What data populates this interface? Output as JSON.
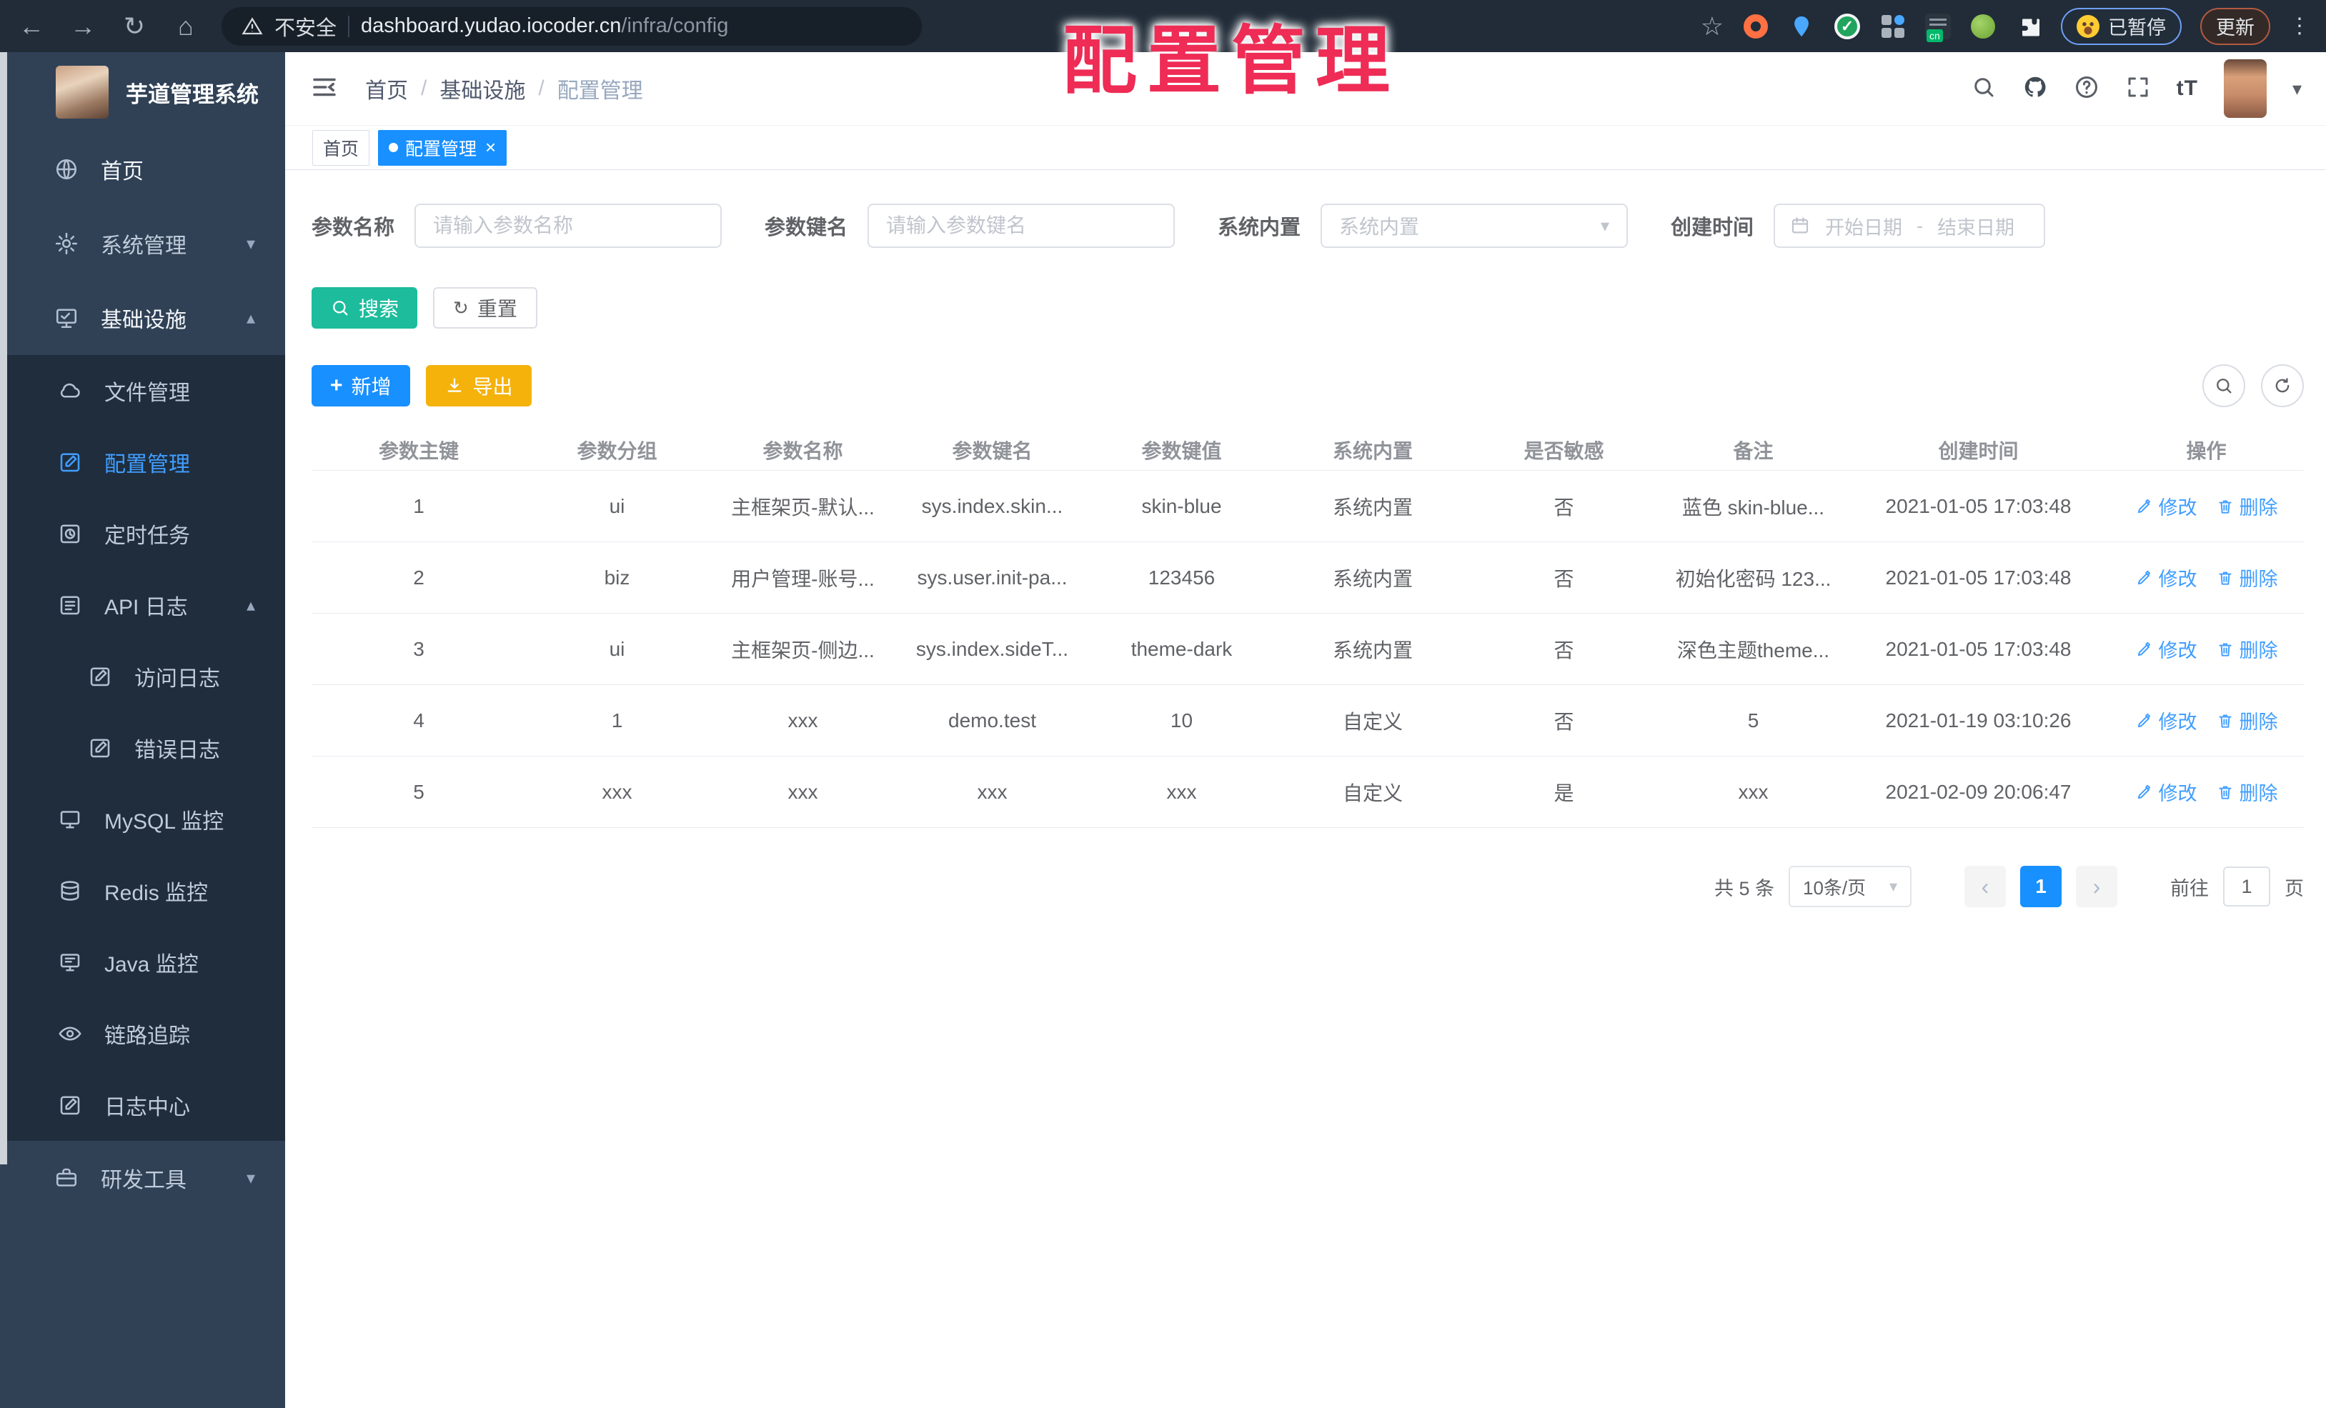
{
  "overlay": {
    "title": "配置管理"
  },
  "browser": {
    "back": "←",
    "forward": "→",
    "reload": "↻",
    "home": "⌂",
    "star": "☆",
    "menu_dots": "⋮",
    "security_label": "不安全",
    "url_host": "dashboard.yudao.iocoder.cn",
    "url_path": "/infra/config",
    "paused_label": "已暂停",
    "update_label": "更新"
  },
  "icons": {
    "caret_down": "▾",
    "caret_up": "▴",
    "close": "×",
    "plus": "+",
    "refresh": "↻",
    "prev": "‹",
    "next": "›",
    "breadcrumb_sep": "/",
    "font_size": "tT",
    "avatar_caret": "▾"
  },
  "sidebar": {
    "app_title": "芋道管理系统",
    "home": "首页",
    "system": "系统管理",
    "infra": "基础设施",
    "file": "文件管理",
    "config": "配置管理",
    "job": "定时任务",
    "api_log": "API 日志",
    "access_log": "访问日志",
    "error_log": "错误日志",
    "mysql": "MySQL 监控",
    "redis": "Redis 监控",
    "java": "Java 监控",
    "trace": "链路追踪",
    "log_center": "日志中心",
    "dev": "研发工具"
  },
  "breadcrumb": [
    "首页",
    "基础设施",
    "配置管理"
  ],
  "tabs": [
    {
      "label": "首页"
    },
    {
      "label": "配置管理"
    }
  ],
  "filters": {
    "name_label": "参数名称",
    "name_placeholder": "请输入参数名称",
    "key_label": "参数键名",
    "key_placeholder": "请输入参数键名",
    "builtin_label": "系统内置",
    "builtin_placeholder": "系统内置",
    "created_label": "创建时间",
    "date_start_placeholder": "开始日期",
    "date_separator": "-",
    "date_end_placeholder": "结束日期"
  },
  "actions": {
    "search": "搜索",
    "reset": "重置",
    "add": "新增",
    "export": "导出"
  },
  "table": {
    "headers": [
      "参数主键",
      "参数分组",
      "参数名称",
      "参数键名",
      "参数键值",
      "系统内置",
      "是否敏感",
      "备注",
      "创建时间",
      "操作"
    ],
    "edit_label": "修改",
    "delete_label": "删除",
    "rows": [
      {
        "id": "1",
        "group": "ui",
        "name": "主框架页-默认...",
        "key": "sys.index.skin...",
        "value": "skin-blue",
        "builtin": "系统内置",
        "sensitive": "否",
        "remark": "蓝色 skin-blue...",
        "created": "2021-01-05 17:03:48"
      },
      {
        "id": "2",
        "group": "biz",
        "name": "用户管理-账号...",
        "key": "sys.user.init-pa...",
        "value": "123456",
        "builtin": "系统内置",
        "sensitive": "否",
        "remark": "初始化密码 123...",
        "created": "2021-01-05 17:03:48"
      },
      {
        "id": "3",
        "group": "ui",
        "name": "主框架页-侧边...",
        "key": "sys.index.sideT...",
        "value": "theme-dark",
        "builtin": "系统内置",
        "sensitive": "否",
        "remark": "深色主题theme...",
        "created": "2021-01-05 17:03:48"
      },
      {
        "id": "4",
        "group": "1",
        "name": "xxx",
        "key": "demo.test",
        "value": "10",
        "builtin": "自定义",
        "sensitive": "否",
        "remark": "5",
        "created": "2021-01-19 03:10:26"
      },
      {
        "id": "5",
        "group": "xxx",
        "name": "xxx",
        "key": "xxx",
        "value": "xxx",
        "builtin": "自定义",
        "sensitive": "是",
        "remark": "xxx",
        "created": "2021-02-09 20:06:47"
      }
    ]
  },
  "pagination": {
    "total": "共 5 条",
    "page_size": "10条/页",
    "current_page": "1",
    "goto_label": "前往",
    "goto_value": "1",
    "page_unit": "页"
  },
  "colors": {
    "accent_blue": "#1890ff",
    "link_blue": "#409eff",
    "teal": "#1cbc9c",
    "warning_yellow": "#f4b20b",
    "overlay_red": "#ee2c55",
    "sidebar_bg": "#304156",
    "submenu_bg": "#1f2d3d"
  }
}
